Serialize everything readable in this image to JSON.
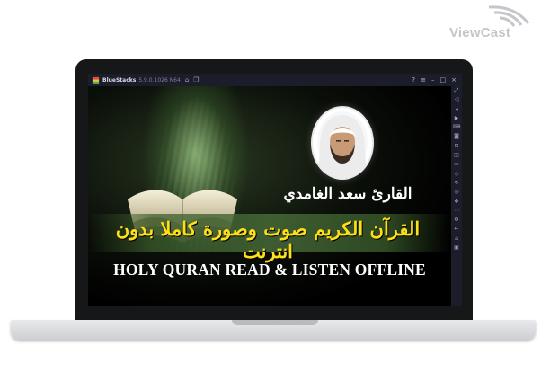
{
  "watermark": {
    "brand": "ViewCast"
  },
  "emulator": {
    "app_name": "BlueStacks",
    "version": "5.9.0.1026 N64",
    "title_icons": [
      "home-icon",
      "multi-instance-icon"
    ],
    "window_controls": [
      "help-icon",
      "menu-icon",
      "minimize-icon",
      "maximize-icon",
      "close-icon"
    ],
    "sidebar_tools": [
      "fullscreen-icon",
      "volume-up-icon",
      "volume-down-icon",
      "video-icon",
      "keyboard-icon",
      "gamepad-icon",
      "apk-install-icon",
      "screenshot-icon",
      "folder-icon",
      "shake-icon",
      "rotate-icon",
      "macro-icon",
      "eco-mode-icon",
      "more-icon",
      "settings-icon",
      "back-icon",
      "home-icon",
      "recent-apps-icon"
    ]
  },
  "app": {
    "reciter_name": "القارئ سعد الغامدي",
    "arabic_title": "القرآن الكريم صوت وصورة كاملا بدون انترنت",
    "english_title": "HOLY QURAN READ & LISTEN OFFLINE"
  },
  "colors": {
    "arabic_title": "#ffdf17",
    "english_title": "#ffffff",
    "emulator_chrome": "#1b1d2a",
    "laptop_bezel": "#151719"
  }
}
